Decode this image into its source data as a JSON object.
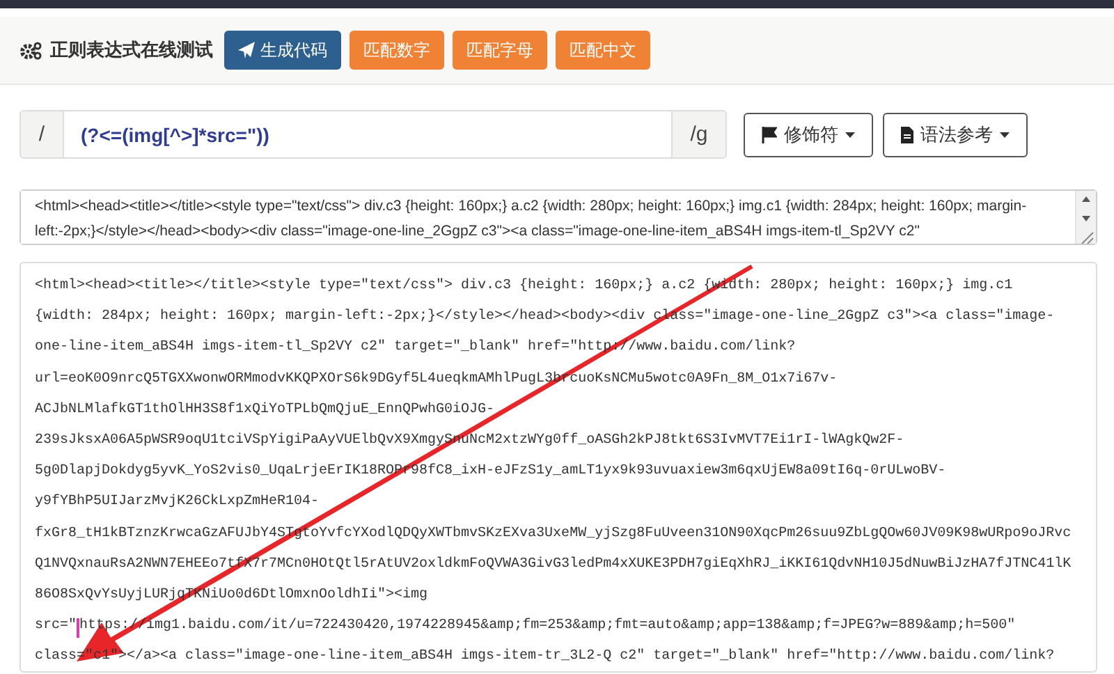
{
  "header": {
    "title": "正则表达式在线测试",
    "buttons": [
      {
        "label": "生成代码",
        "kind": "primary"
      },
      {
        "label": "匹配数字",
        "kind": "preset"
      },
      {
        "label": "匹配字母",
        "kind": "preset"
      },
      {
        "label": "匹配中文",
        "kind": "preset"
      }
    ]
  },
  "regex": {
    "prefix": "/",
    "value": "(?<=(img[^>]*src=\"))",
    "suffix": "/g",
    "menus": [
      {
        "label": "修饰符",
        "kind": "flag"
      },
      {
        "label": "语法参考",
        "kind": "doc"
      }
    ]
  },
  "source": {
    "value": "<html><head><title></title><style type=\"text/css\"> div.c3 {height: 160px;} a.c2 {width: 280px; height: 160px;} img.c1 {width: 284px; height: 160px; margin-left:-2px;}</style></head><body><div class=\"image-one-line_2GgpZ c3\"><a class=\"image-one-line-item_aBS4H imgs-item-tl_Sp2VY c2\""
  },
  "result": {
    "lines": [
      {
        "kind": "plain",
        "text": "<html><head><title></title><style type=\"text/css\"> div.c3 {height: 160px;} a.c2 {width: 280px; height: 160px;} img.c1"
      },
      {
        "kind": "plain",
        "text": "{width: 284px; height: 160px; margin-left:-2px;}</style></head><body><div class=\"image-one-line_2GgpZ c3\"><a class=\"image-"
      },
      {
        "kind": "plain",
        "text": "one-line-item_aBS4H imgs-item-tl_Sp2VY c2\" target=\"_blank\" href=\"http://www.baidu.com/link?"
      },
      {
        "kind": "plain",
        "text": "url=eoK0O9nrcQ5TGXXwonwORMmodvKKQPXOrS6k9DGyf5L4ueqkmAMhlPugL3brcuoKsNCMu5wotc0A9Fn_8M_O1x7i67v-"
      },
      {
        "kind": "plain",
        "text": "ACJbNLMlafkGT1thOlHH3S8f1xQiYoTPLbQmQjuE_EnnQPwhG0iOJG-"
      },
      {
        "kind": "plain",
        "text": "239sJksxA06A5pWSR9oqU1tciVSpYigiPaAyVUElbQvX9XmgySnuNcM2xtzWYg0ff_oASGh2kPJ8tkt6S3IvMVT7Ei1rI-lWAgkQw2F-"
      },
      {
        "kind": "plain",
        "text": "5g0DlapjDokdyg5yvK_YoS2vis0_UqaLrjeErIK18ROPr98fC8_ixH-eJFzS1y_amLT1yx9k93uvuaxiew3m6qxUjEW8a09tI6q-0rULwoBV-"
      },
      {
        "kind": "plain",
        "text": "y9fYBhP5UIJarzMvjK26CkLxpZmHeR104-"
      },
      {
        "kind": "plain",
        "text": "fxGr8_tH1kBTznzKrwcaGzAFUJbY4STgtoYvfcYXodlQDQyXWTbmvSKzEXva3UxeMW_yjSzg8FuUveen31ON90XqcPm26suu9ZbLgQOw60JV09K98wURpo9oJRvc"
      },
      {
        "kind": "plain",
        "text": "Q1NVQxnauRsA2NWN7EHEEo7tfX7r7MCn0HOtQtl5rAtUV2oxldkmFoQVWA3GivG3ledPm4xXUKE3PDH7giEqXhRJ_iKKI61QdvNH10J5dNuwBiJzHA7fJTNC41lK"
      },
      {
        "kind": "plain",
        "text": "86O8SxQvYsUyjLURjqTKNiUo0d6DtlOmxnOoldhIi\"><img"
      },
      {
        "kind": "match",
        "before": "src=\"",
        "after": "https://img1.baidu.com/it/u=722430420,1974228945&amp;fm=253&amp;fmt=auto&amp;app=138&amp;f=JPEG?w=889&amp;h=500\""
      },
      {
        "kind": "plain",
        "text": "class=\"c1\"></a><a class=\"image-one-line-item_aBS4H imgs-item-tr_3L2-Q c2\" target=\"_blank\" href=\"http://www.baidu.com/link?"
      }
    ]
  }
}
